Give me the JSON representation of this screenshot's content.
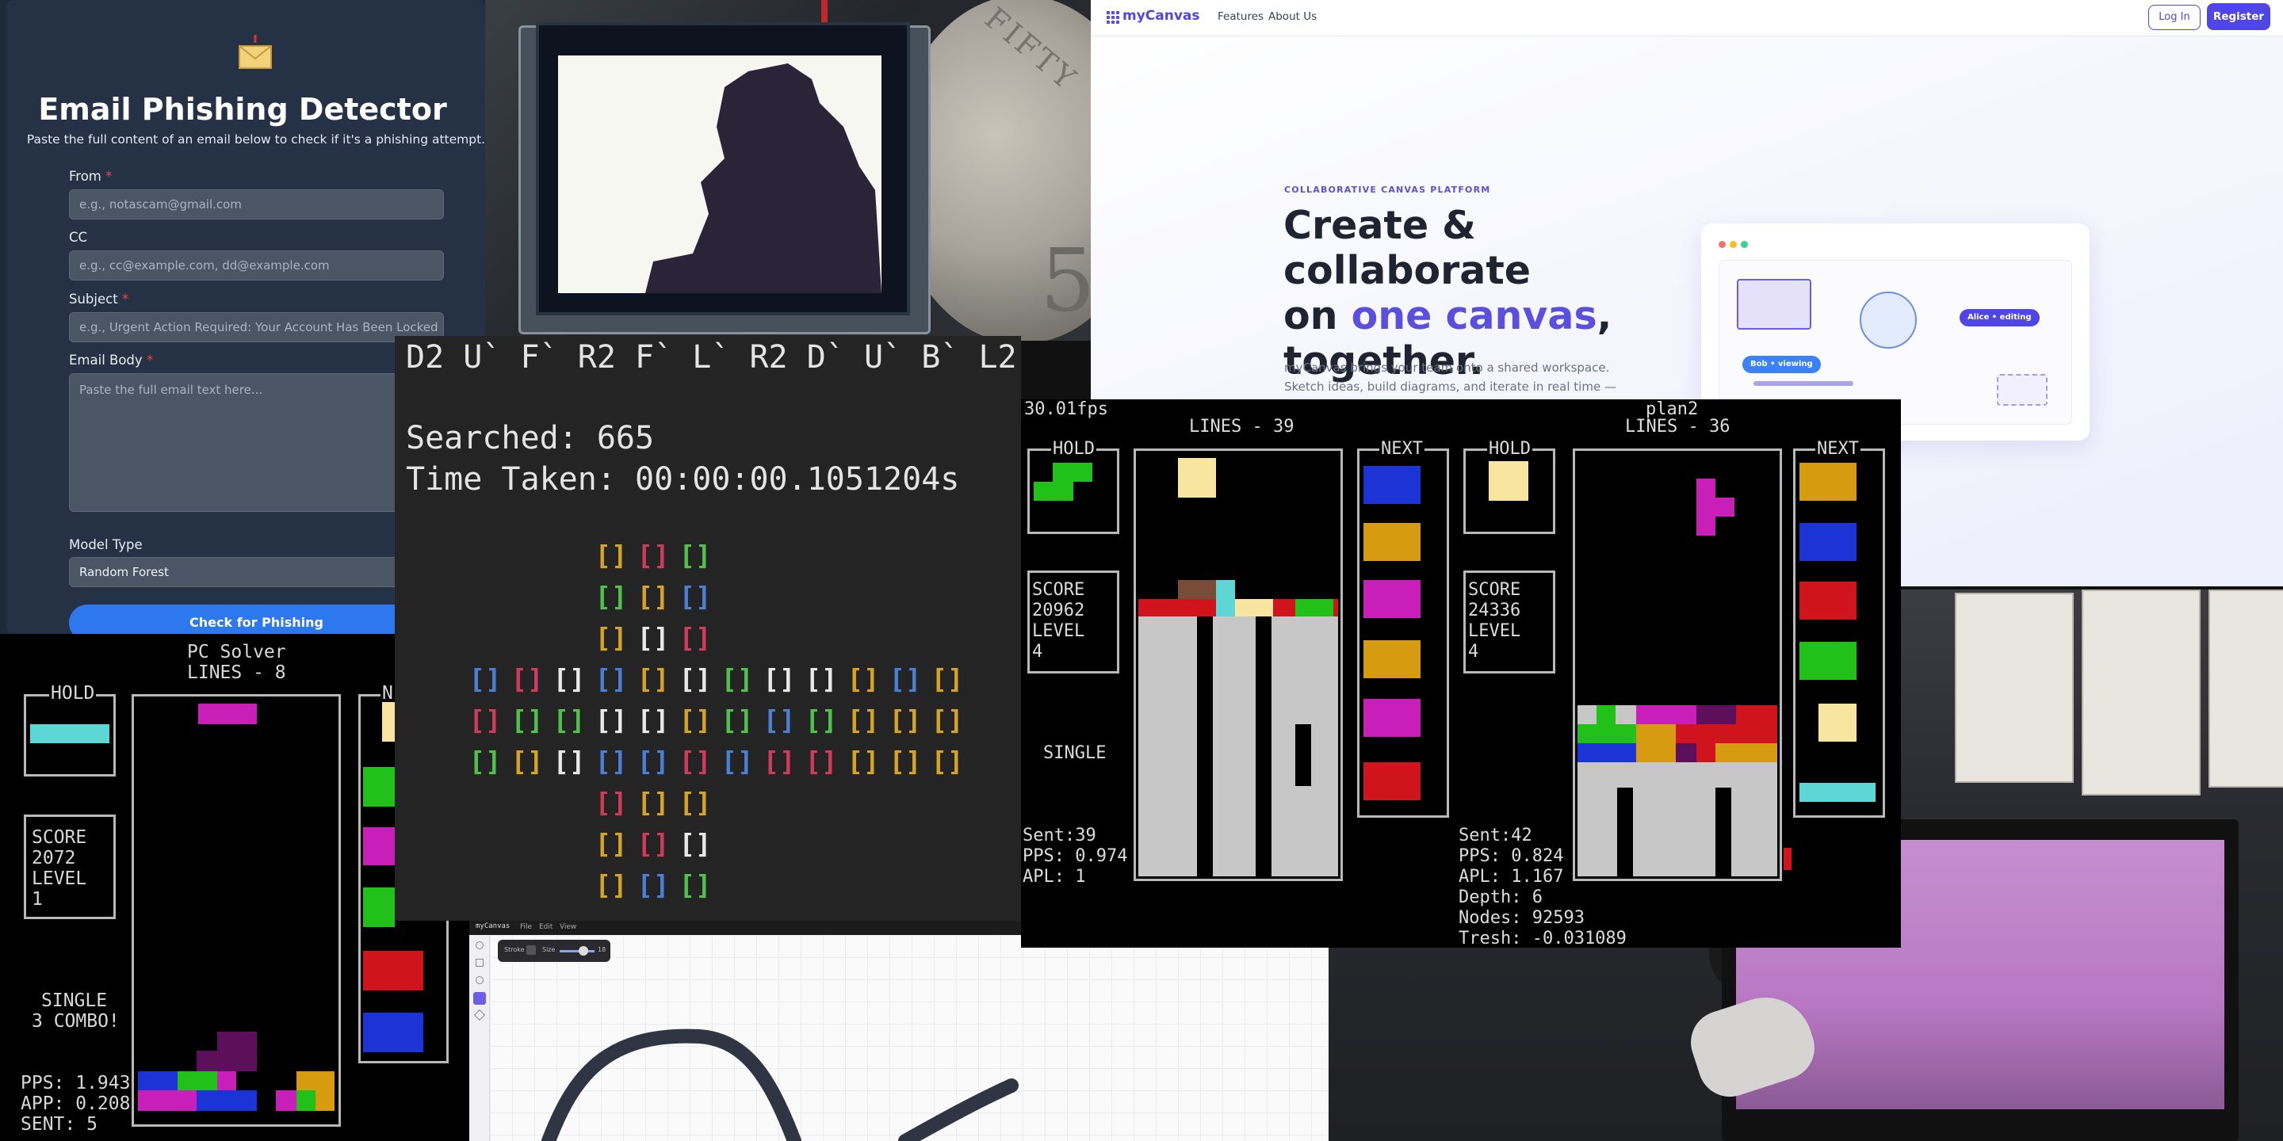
{
  "email": {
    "title": "Email Phishing Detector",
    "subtitle": "Paste the full content of an email below to check if it's a phishing attempt.",
    "from_label": "From",
    "from_placeholder": "e.g., notascam@gmail.com",
    "cc_label": "CC",
    "cc_placeholder": "e.g., cc@example.com, dd@example.com",
    "subject_label": "Subject",
    "subject_placeholder": "e.g., Urgent Action Required: Your Account Has Been Locked",
    "body_label": "Email Body",
    "body_placeholder": "Paste the full email text here...",
    "required_mark": "*",
    "model_label": "Model Type",
    "model_value": "Random Forest",
    "check_button": "Check for Phishing"
  },
  "coin": {
    "rim_text": "FIFTY",
    "numeral": "5"
  },
  "landing": {
    "brand": "myCanvas",
    "nav": [
      "Features",
      "About Us"
    ],
    "login": "Log In",
    "register": "Register",
    "eyebrow": "COLLABORATIVE CANVAS PLATFORM",
    "hero_1": "Create & collaborate",
    "hero_2a": "on ",
    "hero_2b": "one canvas",
    "hero_2c": ",",
    "hero_3": "together.",
    "desc_1": "myCanvas brings your team onto a shared workspace.",
    "desc_2": "Sketch ideas, build diagrams, and iterate in real time — no",
    "pill_alice": "Alice • editing",
    "pill_bob": "Bob • viewing"
  },
  "pc_solver": {
    "title_1": "PC Solver",
    "title_2": "LINES - 8",
    "hold": "HOLD",
    "next": "NE",
    "score_lines": [
      "SCORE",
      "2072",
      "LEVEL",
      "1"
    ],
    "clear_lines": [
      "SINGLE",
      "3 COMBO!"
    ],
    "stats": [
      "PPS: 1.943",
      "APP: 0.208",
      "SENT: 5"
    ]
  },
  "terminal": {
    "moves": "D2 U` F` R2 F` L` R2 D` U` B` L2",
    "searched": "Searched: 665",
    "time": "Time Taken: 00:00:00.1051204s",
    "cube_glyph": "[]",
    "cube_rows": [
      {
        "indent": 3,
        "colors": [
          "Y",
          "R",
          "G"
        ]
      },
      {
        "indent": 3,
        "colors": [
          "G",
          "Y",
          "B"
        ]
      },
      {
        "indent": 3,
        "colors": [
          "Y",
          "W",
          "R"
        ]
      },
      {
        "indent": 0,
        "colors": [
          "B",
          "R",
          "W",
          "B",
          "Y",
          "W",
          "G",
          "W",
          "W",
          "Y",
          "B",
          "Y"
        ]
      },
      {
        "indent": 0,
        "colors": [
          "R",
          "G",
          "G",
          "W",
          "W",
          "Y",
          "G",
          "B",
          "G",
          "Y",
          "Y",
          "Y"
        ]
      },
      {
        "indent": 0,
        "colors": [
          "G",
          "Y",
          "W",
          "B",
          "B",
          "R",
          "B",
          "R",
          "R",
          "Y",
          "Y",
          "Y"
        ]
      },
      {
        "indent": 3,
        "colors": [
          "R",
          "Y",
          "Y"
        ]
      },
      {
        "indent": 3,
        "colors": [
          "Y",
          "R",
          "W"
        ]
      },
      {
        "indent": 3,
        "colors": [
          "Y",
          "B",
          "G"
        ]
      }
    ],
    "palette": {
      "Y": "#d6a323",
      "R": "#d13a5a",
      "G": "#4fc24a",
      "B": "#4a7fd6",
      "W": "#e8e8e8"
    }
  },
  "draw": {
    "brand": "myCanvas",
    "menu": [
      "File",
      "Edit",
      "View"
    ],
    "stroke_label": "Stroke",
    "size_label": "Size",
    "size_value": "18"
  },
  "dual": {
    "fps": "30.01fps",
    "p1_lines": "LINES - 39",
    "p2_name": "plan2",
    "p2_lines": "LINES - 36",
    "hold": "HOLD",
    "next": "NEXT",
    "p1_score": [
      "SCORE",
      "20962",
      "LEVEL",
      "4"
    ],
    "p2_score": [
      "SCORE",
      "24336",
      "LEVEL",
      "4"
    ],
    "p1_clear": "SINGLE",
    "p1_stats": [
      "Sent:39",
      "PPS: 0.974",
      "APL: 1"
    ],
    "p2_stats": [
      "Sent:42",
      "PPS: 0.824",
      "APL: 1.167",
      "Depth: 6",
      "Nodes: 92593",
      "Tresh: -0.031089"
    ]
  },
  "colors": {
    "accent": "#4f46e5",
    "email_button": "#2e78ee",
    "tetris_cyan": "#5fd6d6",
    "tetris_magenta": "#c81fb8",
    "tetris_green": "#22c11a",
    "tetris_blue": "#1c33d6",
    "tetris_red": "#d0141e",
    "tetris_yellow": "#f8e6a0",
    "tetris_orange": "#d69b10"
  }
}
